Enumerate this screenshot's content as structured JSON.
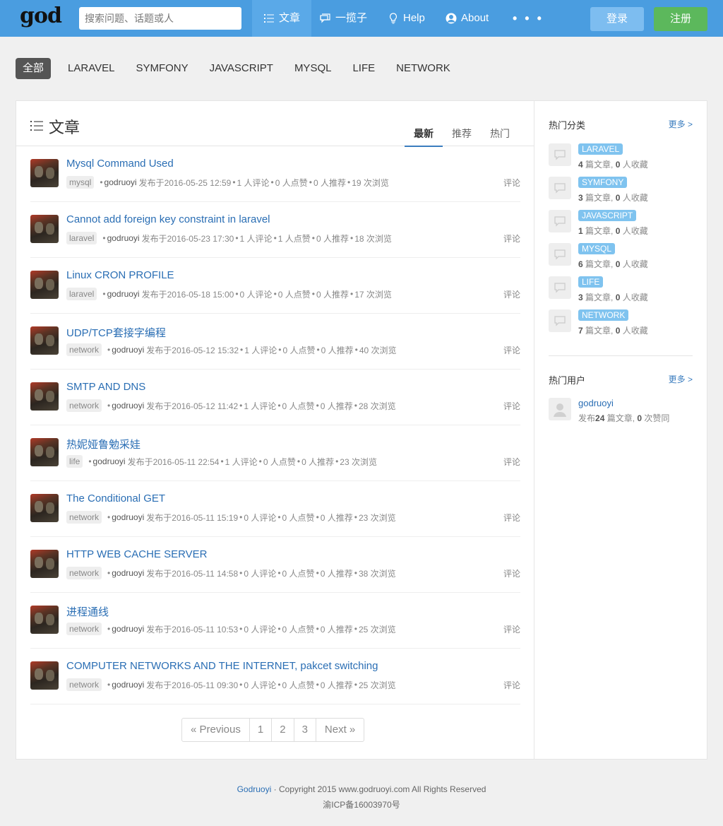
{
  "navbar": {
    "logo": "god",
    "search_placeholder": "搜索问题、话题或人",
    "items": [
      {
        "label": "文章",
        "icon": "list-icon"
      },
      {
        "label": "一揽子",
        "icon": "chat-icon"
      },
      {
        "label": "Help",
        "icon": "bulb-icon"
      },
      {
        "label": "About",
        "icon": "user-circle-icon"
      }
    ],
    "more": "• • •",
    "login": "登录",
    "register": "注册"
  },
  "categories": [
    "全部",
    "LARAVEL",
    "SYMFONY",
    "JAVASCRIPT",
    "MYSQL",
    "LIFE",
    "NETWORK"
  ],
  "main": {
    "title": "文章",
    "sort_tabs": [
      "最新",
      "推荐",
      "热门"
    ],
    "articles": [
      {
        "title": "Mysql Command Used",
        "tag": "mysql",
        "author": "godruoyi",
        "date": "发布于2016-05-25 12:59",
        "comments": "1 人评论",
        "likes": "0 人点赞",
        "recs": "0 人推荐",
        "views": "19 次浏览",
        "action": "评论"
      },
      {
        "title": "Cannot add foreign key constraint in laravel",
        "tag": "laravel",
        "author": "godruoyi",
        "date": "发布于2016-05-23 17:30",
        "comments": "1 人评论",
        "likes": "1 人点赞",
        "recs": "0 人推荐",
        "views": "18 次浏览",
        "action": "评论"
      },
      {
        "title": "Linux CRON PROFILE",
        "tag": "laravel",
        "author": "godruoyi",
        "date": "发布于2016-05-18 15:00",
        "comments": "0 人评论",
        "likes": "0 人点赞",
        "recs": "0 人推荐",
        "views": "17 次浏览",
        "action": "评论"
      },
      {
        "title": "UDP/TCP套接字编程",
        "tag": "network",
        "author": "godruoyi",
        "date": "发布于2016-05-12 15:32",
        "comments": "1 人评论",
        "likes": "0 人点赞",
        "recs": "0 人推荐",
        "views": "40 次浏览",
        "action": "评论"
      },
      {
        "title": "SMTP AND DNS",
        "tag": "network",
        "author": "godruoyi",
        "date": "发布于2016-05-12 11:42",
        "comments": "1 人评论",
        "likes": "0 人点赞",
        "recs": "0 人推荐",
        "views": "28 次浏览",
        "action": "评论"
      },
      {
        "title": "热妮娅鲁勉采娃",
        "tag": "life",
        "author": "godruoyi",
        "date": "发布于2016-05-11 22:54",
        "comments": "1 人评论",
        "likes": "0 人点赞",
        "recs": "0 人推荐",
        "views": "23 次浏览",
        "action": "评论"
      },
      {
        "title": "The Conditional GET",
        "tag": "network",
        "author": "godruoyi",
        "date": "发布于2016-05-11 15:19",
        "comments": "0 人评论",
        "likes": "0 人点赞",
        "recs": "0 人推荐",
        "views": "23 次浏览",
        "action": "评论"
      },
      {
        "title": "HTTP WEB CACHE SERVER",
        "tag": "network",
        "author": "godruoyi",
        "date": "发布于2016-05-11 14:58",
        "comments": "0 人评论",
        "likes": "0 人点赞",
        "recs": "0 人推荐",
        "views": "38 次浏览",
        "action": "评论"
      },
      {
        "title": "进程通线",
        "tag": "network",
        "author": "godruoyi",
        "date": "发布于2016-05-11 10:53",
        "comments": "0 人评论",
        "likes": "0 人点赞",
        "recs": "0 人推荐",
        "views": "25 次浏览",
        "action": "评论"
      },
      {
        "title": "COMPUTER NETWORKS AND THE INTERNET, pakcet switching",
        "tag": "network",
        "author": "godruoyi",
        "date": "发布于2016-05-11 09:30",
        "comments": "0 人评论",
        "likes": "0 人点赞",
        "recs": "0 人推荐",
        "views": "25 次浏览",
        "action": "评论"
      }
    ],
    "pagination": [
      "« Previous",
      "1",
      "2",
      "3",
      "Next »"
    ]
  },
  "sidebar": {
    "hot_categories_label": "热门分类",
    "more": "更多 >",
    "hot_categories": [
      {
        "name": "LARAVEL",
        "articles": "4",
        "articles_unit": " 篇文章, ",
        "favs": "0",
        "favs_unit": " 人收藏"
      },
      {
        "name": "SYMFONY",
        "articles": "3",
        "articles_unit": " 篇文章, ",
        "favs": "0",
        "favs_unit": " 人收藏"
      },
      {
        "name": "JAVASCRIPT",
        "articles": "1",
        "articles_unit": " 篇文章, ",
        "favs": "0",
        "favs_unit": " 人收藏"
      },
      {
        "name": "MYSQL",
        "articles": "6",
        "articles_unit": " 篇文章, ",
        "favs": "0",
        "favs_unit": " 人收藏"
      },
      {
        "name": "LIFE",
        "articles": "3",
        "articles_unit": " 篇文章, ",
        "favs": "0",
        "favs_unit": " 人收藏"
      },
      {
        "name": "NETWORK",
        "articles": "7",
        "articles_unit": " 篇文章, ",
        "favs": "0",
        "favs_unit": " 人收藏"
      }
    ],
    "hot_users_label": "热门用户",
    "hot_users": [
      {
        "name": "godruoyi",
        "prefix": "发布",
        "articles": "24",
        "articles_unit": " 篇文章, ",
        "agrees": "0",
        "agrees_unit": " 次赞同"
      }
    ]
  },
  "footer": {
    "brand": "Godruoyi",
    "copyright": " · Copyright 2015 www.godruoyi.com All Rights Reserved",
    "icp": "渝ICP备16003970号"
  },
  "colors": {
    "navbar": "#4a9de0",
    "link": "#2a6eb4",
    "register": "#5cb85c",
    "category_tag": "#7fc3ef"
  }
}
